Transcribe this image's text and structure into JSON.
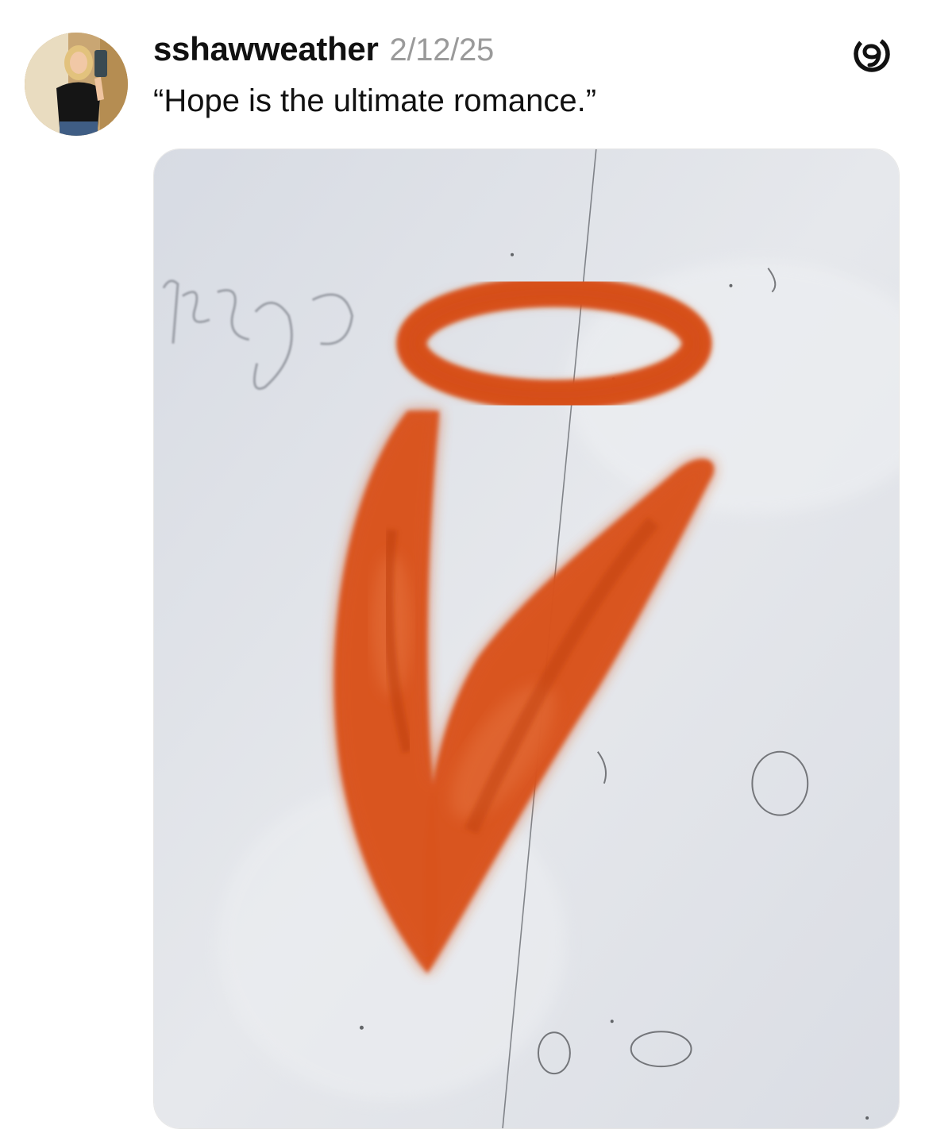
{
  "post": {
    "username": "sshawweather",
    "timestamp": "2/12/25",
    "caption": "“Hope is the ultimate romance.”",
    "avatar_icon": "user-avatar-photo",
    "app_icon": "threads-logo-icon",
    "image": {
      "subject": "orange-spray-paint-graffiti-on-white-wall-photo",
      "colors": {
        "wall": "#dfe2e8",
        "paint": "#d9531a"
      }
    }
  }
}
